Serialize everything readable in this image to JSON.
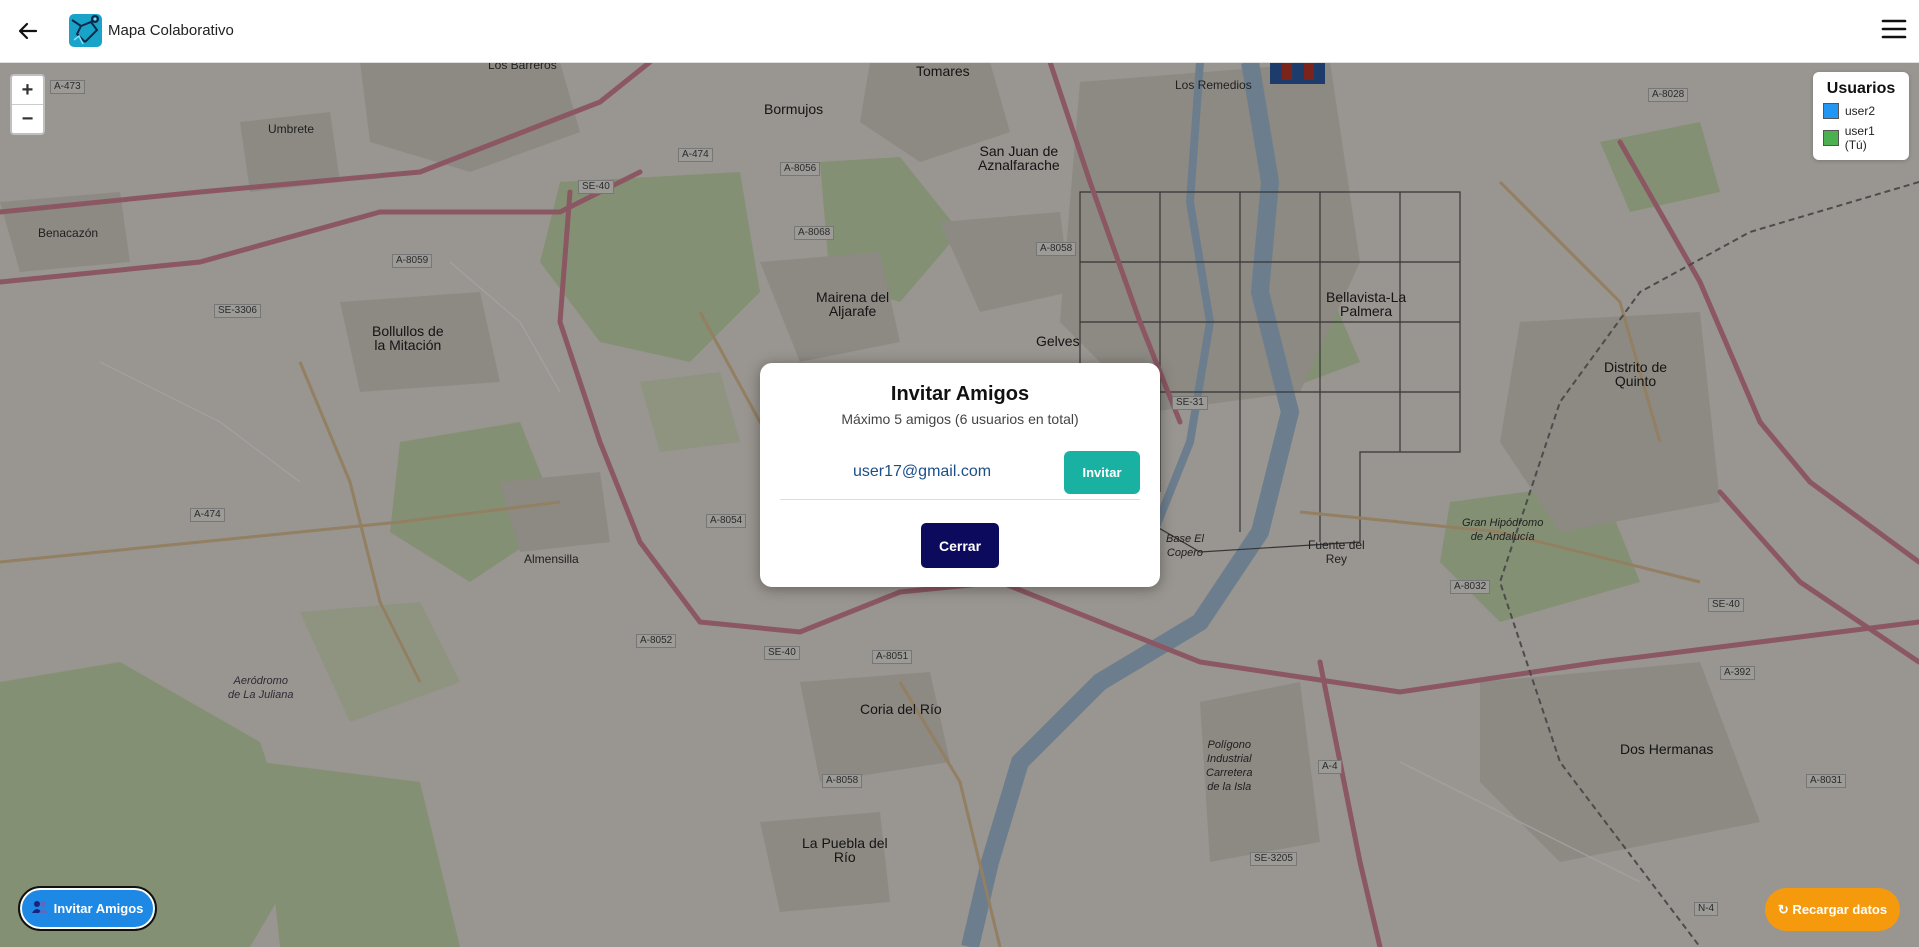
{
  "header": {
    "title": "Mapa Colaborativo",
    "back_icon": "arrow-left-icon",
    "menu_icon": "hamburger-menu-icon"
  },
  "map": {
    "zoom_in": "+",
    "zoom_out": "−",
    "place_labels": {
      "los_barreros": "Los Barreros",
      "tomares": "Tomares",
      "los_remedios": "Los Remedios",
      "umbrete": "Umbrete",
      "bormujos": "Bormujos",
      "benacazon": "Benacazón",
      "san_juan": "San Juan de\nAznalfarache",
      "mairena": "Mairena del\nAljarafe",
      "bollullos": "Bollullos de\nla Mitación",
      "gelves": "Gelves",
      "bellavista": "Bellavista-La\nPalmera",
      "distrito_quinto": "Distrito de\nQuinto",
      "almensilla": "Almensilla",
      "fuente_del_rey": "Fuente del\nRey",
      "coria": "Coria del Río",
      "dos_hermanas": "Dos Hermanas",
      "la_puebla": "La Puebla del\nRío",
      "aerodromo": "Aeródromo\nde La Juliana",
      "poligono": "Polígono\nIndustrial\nCarretera\nde la Isla",
      "base_copero": "Base El\nCopero",
      "gran_hipodromo": "Gran Hipódromo\nde Andalucía"
    },
    "road_labels": {
      "a473": "A-473",
      "a474_top": "A-474",
      "a8056": "A-8056",
      "se40_top": "SE-40",
      "a8059": "A-8059",
      "a8068": "A-8068",
      "a8058": "A-8058",
      "se3306": "SE-3306",
      "a474_left": "A-474",
      "a8054": "A-8054",
      "a8052": "A-8052",
      "se40_mid": "SE-40",
      "a8051": "A-8051",
      "a8058_low": "A-8058",
      "se31": "SE-31",
      "a8032": "A-8032",
      "se40_right": "SE-40",
      "a392": "A-392",
      "a8031": "A-8031",
      "se3205": "SE-3205",
      "a4": "A-4",
      "a8028": "A-8028",
      "n4": "N-4"
    }
  },
  "legend": {
    "title": "Usuarios",
    "users": [
      {
        "name": "user2",
        "color": "#2196f3"
      },
      {
        "name": "user1 (Tú)",
        "color": "#4caf50"
      }
    ]
  },
  "buttons": {
    "invite_friends": "Invitar Amigos",
    "invite_friends_icon": "people-icon",
    "reload": "↻ Recargar datos"
  },
  "modal": {
    "title": "Invitar Amigos",
    "subtitle": "Máximo 5 amigos (6 usuarios en total)",
    "email": "user17@gmail.com",
    "invite_label": "Invitar",
    "close_label": "Cerrar"
  }
}
